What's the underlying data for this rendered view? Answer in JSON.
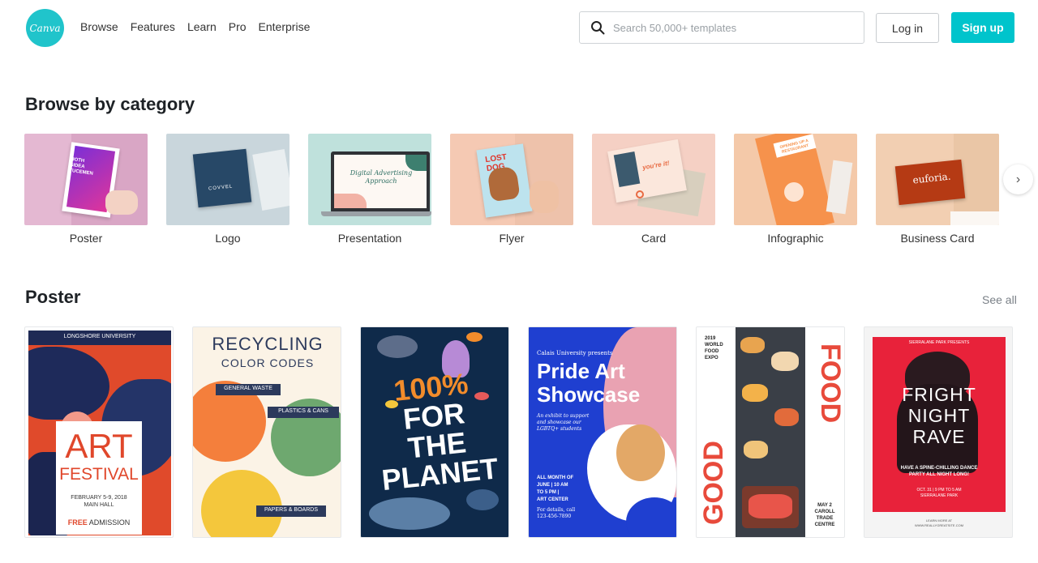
{
  "header": {
    "logo_text": "Canva",
    "nav": [
      "Browse",
      "Features",
      "Learn",
      "Pro",
      "Enterprise"
    ],
    "search_placeholder": "Search 50,000+ templates",
    "login_label": "Log in",
    "signup_label": "Sign up",
    "accent_color": "#00c4cc"
  },
  "browse": {
    "title": "Browse by category",
    "categories": [
      {
        "label": "Poster"
      },
      {
        "label": "Logo"
      },
      {
        "label": "Presentation"
      },
      {
        "label": "Flyer"
      },
      {
        "label": "Card"
      },
      {
        "label": "Infographic"
      },
      {
        "label": "Business Card"
      }
    ],
    "thumb_texts": {
      "poster": "HOTH\nSIDEA\nTUCEMEN",
      "logo": "COVVEL",
      "presentation_line1": "Digital Advertising",
      "presentation_line2": "Approach",
      "flyer": "LOST DOG",
      "card": "you're it!",
      "infographic": "OPENING UP A RESTAURANT",
      "business": "euforia."
    }
  },
  "poster_section": {
    "title": "Poster",
    "see_all": "See all",
    "posters": {
      "art": {
        "top": "LONGSHORE UNIVERSITY",
        "big1": "ART",
        "big2": "FESTIVAL",
        "date": "FEBRUARY 5-9, 2018",
        "place": "MAIN HALL",
        "free": "FREE",
        "admission": "ADMISSION"
      },
      "recycle": {
        "title1": "RECYCLING",
        "title2": "COLOR CODES",
        "tag1": "GENERAL WASTE",
        "tag2": "PLASTICS & CANS",
        "tag3": "PAPERS & BOARDS"
      },
      "planet": {
        "l1": "100%",
        "l2": "FOR",
        "l3": "THE",
        "l4": "PLANET"
      },
      "pride": {
        "kicker": "Calais University presents",
        "title1": "Pride Art",
        "title2": "Showcase",
        "desc1": "An exhibit to support",
        "desc2": "and showcase our",
        "desc3": "LGBTQ+ students",
        "when1": "ALL MONTH OF",
        "when2": "JUNE | 10 AM",
        "when3": "TO 5 PM |",
        "when4": "ART CENTER",
        "details": "For details, call",
        "phone": "123-456-7890"
      },
      "food": {
        "expo1": "2019",
        "expo2": "WORLD",
        "expo3": "FOOD",
        "expo4": "EXPO",
        "word1": "FOOD",
        "word2": "GOOD",
        "date1": "MAY 2",
        "place1": "CAROLL",
        "place2": "TRADE",
        "place3": "CENTRE"
      },
      "rave": {
        "top": "SIERRALANE PARK PRESENTS",
        "l1": "FRIGHT",
        "l2": "NIGHT",
        "l3": "RAVE",
        "sub1": "HAVE A SPINE-CHILLING DANCE",
        "sub2": "PARTY ALL NIGHT LONG!",
        "date": "OCT. 31 | 9 PM TO 5 AM",
        "venue": "SIERRALANE PARK",
        "learn": "LEARN MORE AT",
        "url": "WWW.REALLYGREATSITE.COM"
      }
    }
  }
}
